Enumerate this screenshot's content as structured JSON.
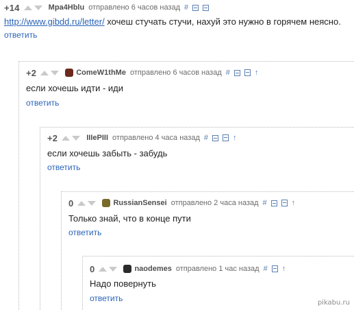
{
  "vote_up_icon": "triangle-up",
  "vote_down_icon": "triangle-down",
  "comments": [
    {
      "rating": "+14",
      "author": "Mpa4Hblu",
      "date": "отправлено 6 часов назад",
      "icons": [
        "#",
        "collapse-box",
        "plus-box"
      ],
      "link_text": "http://www.gibdd.ru/letter/",
      "text": " хочеш стучать стучи, нахуй это нужно в горячем неясно.",
      "reply": "ответить"
    },
    {
      "rating": "+2",
      "author": "ComeW1thMe",
      "avatar_color": "#6b2a1d",
      "date": "отправлено 6 часов назад",
      "icons": [
        "#",
        "collapse-box",
        "save",
        "arrow-up"
      ],
      "text": "если хочешь идти - иди",
      "reply": "ответить"
    },
    {
      "rating": "+2",
      "author": "IIIePIII",
      "date": "отправлено 4 часа назад",
      "icons": [
        "#",
        "collapse-box",
        "save",
        "arrow-up"
      ],
      "text": "если хочешь забыть - забудь",
      "reply": "ответить"
    },
    {
      "rating": "0",
      "author": "RussianSensei",
      "avatar_color": "#7a6a2a",
      "date": "отправлено 2 часа назад",
      "icons": [
        "#",
        "collapse-box",
        "save",
        "arrow-up"
      ],
      "text": "Только знай, что в конце пути",
      "reply": "ответить"
    },
    {
      "rating": "0",
      "author": "naodemes",
      "avatar_color": "#2b2b2b",
      "date": "отправлено 1 час назад",
      "icons": [
        "#",
        "save",
        "arrow-up"
      ],
      "text": "Надо повернуть",
      "reply": "ответить"
    }
  ],
  "watermark": "pikabu.ru"
}
